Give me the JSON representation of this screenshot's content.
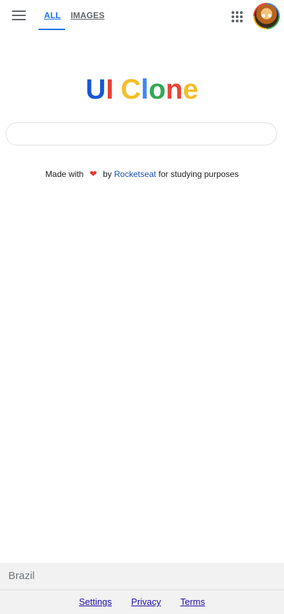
{
  "header": {
    "tabs": [
      {
        "label": "ALL",
        "active": true
      },
      {
        "label": "IMAGES",
        "active": false
      }
    ],
    "menu_icon": "hamburger-menu-icon",
    "apps_icon": "apps-grid-icon",
    "avatar": "user-avatar"
  },
  "logo": {
    "letters": [
      {
        "char": "U",
        "color": "#1558d6"
      },
      {
        "char": "I",
        "color": "#e54033"
      },
      {
        "char": " ",
        "color": "#000000"
      },
      {
        "char": "C",
        "color": "#f4bd2b"
      },
      {
        "char": "l",
        "color": "#4285f4"
      },
      {
        "char": "o",
        "color": "#33a853"
      },
      {
        "char": "n",
        "color": "#ea4335"
      },
      {
        "char": "e",
        "color": "#f4bd2b"
      }
    ]
  },
  "search": {
    "value": "",
    "placeholder": ""
  },
  "credit": {
    "prefix": "Made with",
    "heart_icon": "heart-icon",
    "by": "by",
    "link": "Rocketseat",
    "suffix": "for studying purposes"
  },
  "footer": {
    "country": "Brazil",
    "links": [
      "Settings",
      "Privacy",
      "Terms"
    ]
  }
}
